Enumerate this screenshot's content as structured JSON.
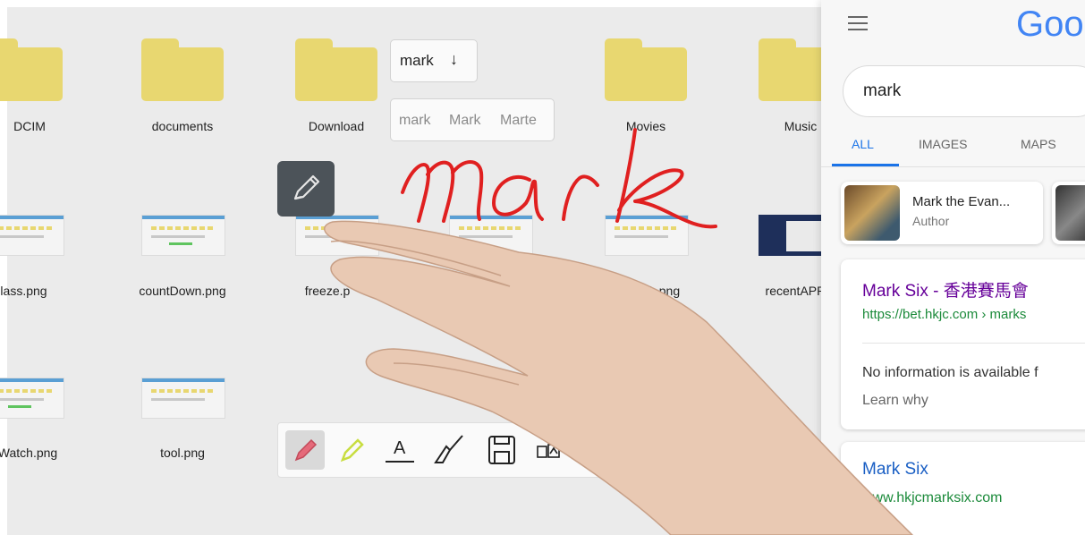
{
  "files": {
    "folders": [
      "DCIM",
      "documents",
      "Download",
      "Movies",
      "Music"
    ],
    "images_row1": [
      "class.png",
      "countDown.png",
      "freeze.p",
      "k.png",
      "recentAPP"
    ],
    "images_row2": [
      "Watch.png",
      "tool.png"
    ]
  },
  "handwriting": {
    "word": "mark",
    "arrow": "↓",
    "candidates": [
      "mark",
      "Mark",
      "Marte"
    ],
    "ink_color": "#e02020"
  },
  "pen_button": {
    "icon": "pencil-icon"
  },
  "toolbar": {
    "tools": [
      "pen-icon",
      "highlighter-icon",
      "text-icon",
      "eraser-brush-icon",
      "save-icon",
      "capture-icon"
    ],
    "text_tool_label": "A"
  },
  "google": {
    "logo": "Goo",
    "search_query": "mark",
    "tabs": [
      "ALL",
      "IMAGES",
      "MAPS"
    ],
    "knowledge_card": {
      "title": "Mark the Evan...",
      "subtitle": "Author"
    },
    "result1": {
      "title": "Mark Six - 香港賽馬會",
      "url": "https://bet.hkjc.com › marks",
      "snippet": "No information is available f",
      "link": "Learn why"
    },
    "result2": {
      "title": "Mark Six",
      "url": "www.hkjcmarksix.com"
    },
    "colors": {
      "link_purple": "#660099",
      "url_green": "#1b8a3a",
      "tab_active": "#1a73e8"
    }
  }
}
